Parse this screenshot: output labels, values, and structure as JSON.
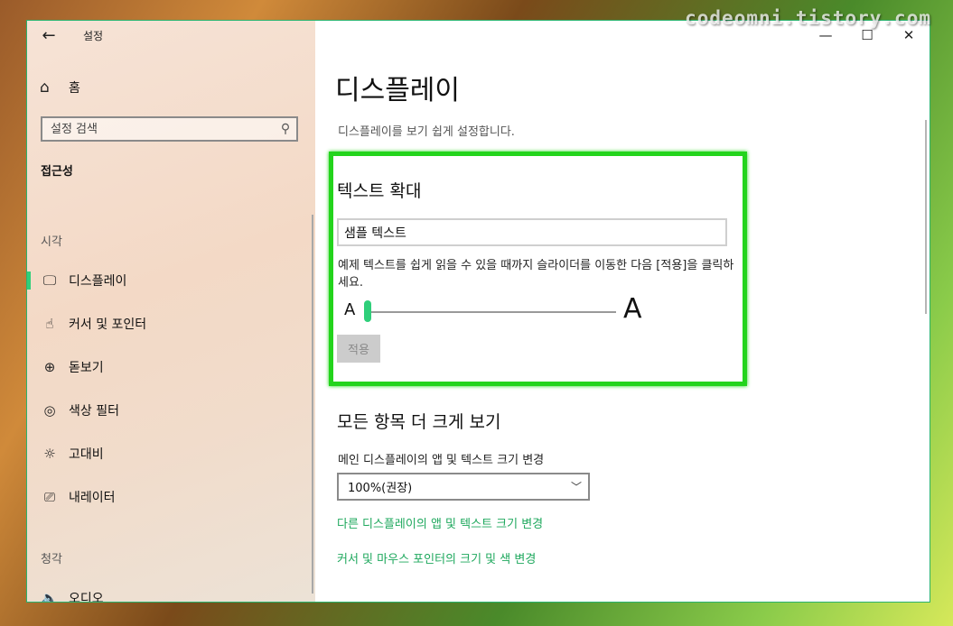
{
  "watermark": "codeomni.tistory.com",
  "window": {
    "app_title": "설정",
    "back_icon": "←",
    "controls": {
      "minimize": "—",
      "maximize": "☐",
      "close": "✕"
    }
  },
  "sidebar": {
    "home_label": "홈",
    "search_placeholder": "설정 검색",
    "section_heading": "접근성",
    "group_vision": "시각",
    "group_hearing": "청각",
    "items": [
      {
        "label": "디스플레이",
        "icon": "display-icon",
        "selected": true
      },
      {
        "label": "커서 및 포인터",
        "icon": "cursor-hand-icon",
        "selected": false
      },
      {
        "label": "돋보기",
        "icon": "magnifier-icon",
        "selected": false
      },
      {
        "label": "색상 필터",
        "icon": "palette-icon",
        "selected": false
      },
      {
        "label": "고대비",
        "icon": "brightness-icon",
        "selected": false
      },
      {
        "label": "내레이터",
        "icon": "narrator-icon",
        "selected": false
      },
      {
        "label": "오디오",
        "icon": "speaker-icon",
        "selected": false
      }
    ]
  },
  "main": {
    "title": "디스플레이",
    "description": "디스플레이를 보기 쉽게 설정합니다.",
    "text_zoom": {
      "title": "텍스트 확대",
      "sample_text": "샘플 텍스트",
      "instructions": "예제 텍스트를 쉽게 읽을 수 있을 때까지 슬라이더를 이동한 다음 [적용]을 클릭하세요.",
      "small_a": "A",
      "large_a": "A",
      "slider_value_pct": 0,
      "apply_label": "적용"
    },
    "make_bigger": {
      "title": "모든 항목 더 크게 보기",
      "dropdown_label": "메인 디스플레이의 앱 및 텍스트 크기 변경",
      "dropdown_value": "100%(권장)",
      "link_other_displays": "다른 디스플레이의 앱 및 텍스트 크기 변경",
      "link_cursor": "커서 및 마우스 포인터의 크기 및 색 변경"
    }
  },
  "colors": {
    "accent": "#2fcf7a",
    "link": "#1ea85d",
    "highlight": "#23d41c"
  }
}
